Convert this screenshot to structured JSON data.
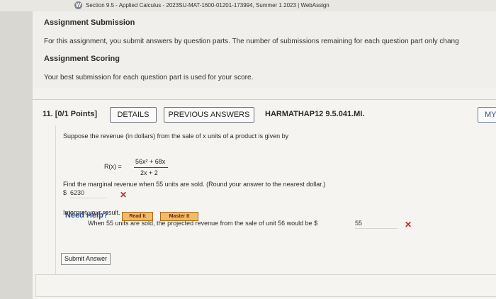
{
  "browser": {
    "tab_icon": "webassign-icon",
    "tab_icon_glyph": "W",
    "tab_title": "Section 9.5 - Applied Calculus - 2023SU-MAT-1600-01201-173994, Summer 1 2023 | WebAssign"
  },
  "assignment": {
    "submission_title": "Assignment Submission",
    "submission_text": "For this assignment, you submit answers by question parts. The number of submissions remaining for each question part only chang",
    "scoring_title": "Assignment Scoring",
    "scoring_text": "Your best submission for each question part is used for your score."
  },
  "question": {
    "number_label": "11.  [0/1 Points]",
    "details_label": "DETAILS",
    "previous_answers_label": "PREVIOUS ANSWERS",
    "code": "HARMATHAP12 9.5.041.MI.",
    "my_notes_label": "MY N",
    "prompt": "Suppose the revenue (in dollars) from the sale of x units of a product is given by",
    "formula_lhs": "R(x)  =",
    "formula_numerator": "56x² + 68x",
    "formula_denominator": "2x + 2",
    "part1_prompt": "Find the marginal revenue when 55 units are sold. (Round your answer to the nearest dollar.)",
    "part1_prefix": "$",
    "part1_answer": "6230",
    "interpret_label": "Interpret your result.",
    "part2_text": "When 55 units are sold, the projected revenue from the sale of unit 56 would be $",
    "part2_answer": "55",
    "need_help_label": "Need Help?",
    "read_it_label": "Read It",
    "master_it_label": "Master It",
    "submit_label": "Submit Answer",
    "incorrect_icon": "x-mark-icon",
    "incorrect_glyph": "✕",
    "colors": {
      "incorrect": "#c8202a",
      "help_button": "#f2bb66",
      "need_help_text": "#2a4b8a"
    }
  }
}
